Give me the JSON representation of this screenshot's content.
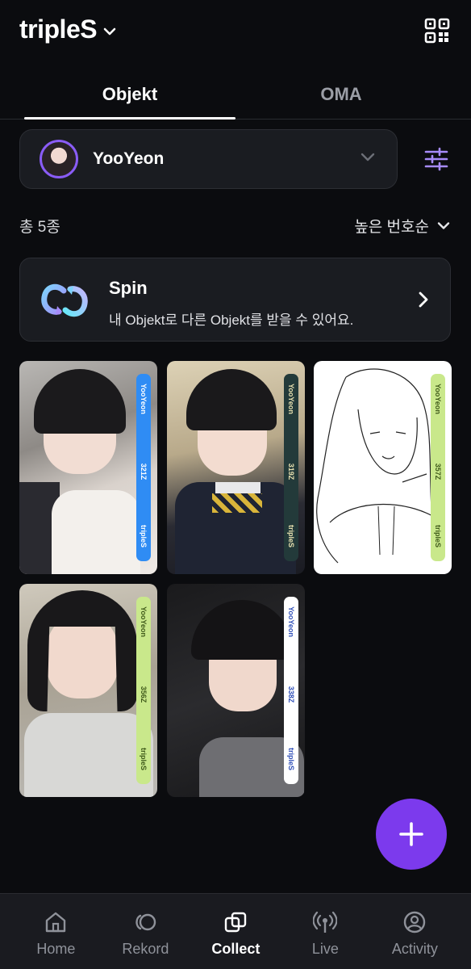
{
  "header": {
    "app_title": "tripleS"
  },
  "tabs": [
    {
      "label": "Objekt",
      "active": true
    },
    {
      "label": "OMA",
      "active": false
    }
  ],
  "member_selector": {
    "selected": "YooYeon"
  },
  "list": {
    "count_label": "총 5종",
    "sort_label": "높은 번호순"
  },
  "spin_banner": {
    "title": "Spin",
    "description": "내 Objekt로 다른 Objekt를 받을 수 있어요."
  },
  "objekts": [
    {
      "member": "YooYeon",
      "serial": "321Z",
      "group": "tripleS",
      "band_color": "#2f8cf4",
      "band_text_color": "#ffffff"
    },
    {
      "member": "YooYeon",
      "serial": "319Z",
      "group": "tripleS",
      "band_color": "#233a3a",
      "band_text_color": "#e8e1b0"
    },
    {
      "member": "YooYeon",
      "serial": "357Z",
      "group": "tripleS",
      "band_color": "#c9e88b",
      "band_text_color": "#3f5a1a"
    },
    {
      "member": "YooYeon",
      "serial": "356Z",
      "group": "tripleS",
      "band_color": "#c9e88b",
      "band_text_color": "#3f5a1a"
    },
    {
      "member": "YooYeon",
      "serial": "338Z",
      "group": "tripleS",
      "band_color": "#ffffff",
      "band_text_color": "#2f4fb8"
    }
  ],
  "fab": {
    "icon": "plus-icon"
  },
  "bottom_nav": [
    {
      "label": "Home",
      "icon": "home-icon",
      "active": false
    },
    {
      "label": "Rekord",
      "icon": "rekord-icon",
      "active": false
    },
    {
      "label": "Collect",
      "icon": "collect-icon",
      "active": true
    },
    {
      "label": "Live",
      "icon": "live-icon",
      "active": false
    },
    {
      "label": "Activity",
      "icon": "activity-icon",
      "active": false
    }
  ],
  "colors": {
    "background": "#0b0c0f",
    "surface": "#1a1c21",
    "accent": "#7c3aed",
    "inactive_text": "#8f929a"
  }
}
